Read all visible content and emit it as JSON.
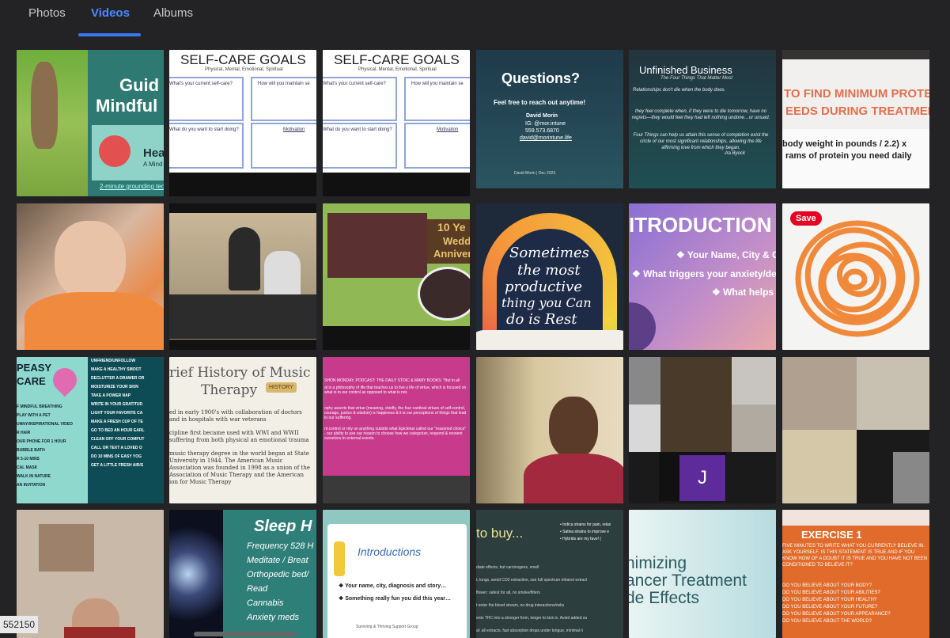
{
  "tabs": [
    {
      "label": "Photos"
    },
    {
      "label": "Videos"
    },
    {
      "label": "Albums"
    }
  ],
  "video_count_label": "552150",
  "tiles": {
    "t1": {
      "title": "Guid",
      "title2": "Mindful",
      "sub": "Hea",
      "sub2": "A Mind",
      "link": "2-minute grounding techni"
    },
    "t2": {
      "title": "SELF-CARE GOALS",
      "sub": "Physical, Mental, Emotional, Spiritual",
      "q1": "What's your current self-care?",
      "q2": "How will you maintain se",
      "q3": "What do you want to start doing?",
      "q4": "Motivation"
    },
    "t3": {
      "title": "SELF-CARE GOALS",
      "sub": "Physical, Mental, Emotional, Spiritual",
      "q1": "What's your current self-care?",
      "q2": "How will you maintain se",
      "q3": "What do you want to start doing?",
      "q4": "Motivation"
    },
    "t4": {
      "title": "Questions?",
      "line1": "Feel free to reach out anytime!",
      "name": "David Morin",
      "ig": "IG: @mor.intune",
      "phone": "559.573.6870",
      "email": "david@morintune.life",
      "footer": "David Morin | Dec 2023"
    },
    "t5": {
      "title": "Unfinished Business",
      "sub": "The Four Things That Matter Most",
      "q1": "Relationships don't die when the body does.",
      "q2": "they feel complete when, if they were to die tomorrow, have no regrets—they would feel they had left nothing undone…or unsaid.",
      "q3": "Four Things can help us attain this sense of completion exist the circle of our most significant relationships, allowing the life affirming love from which they began.",
      "author": "-Ira Byock"
    },
    "t6": {
      "title": "TO FIND MINIMUM PROTEIN",
      "title2": "EEDS DURING TREATMENT",
      "line1": "body weight in pounds / 2.2) x",
      "line2": "rams of protein you need daily"
    },
    "t9": {
      "title": "10 Ye",
      "title2": "Wedd",
      "title3": "Anniver"
    },
    "t10": {
      "l1": "Sometimes",
      "l2": "the most",
      "l3": "productive",
      "l4": "thing you Can",
      "l5": "do is Rest"
    },
    "t11": {
      "title": "ITRODUCTION",
      "l1": "❖ Your Name, City & C",
      "l2": "❖ What triggers your anxiety/de",
      "l3": "❖ What helps"
    },
    "t12": {
      "save": "Save"
    },
    "t13": {
      "title": "PEASY",
      "title2": "CARE",
      "left": [
        "F MINDFUL BREATHING",
        "PLAY WITH A PET",
        "UNNY/INSPIRATIONAL VIDEO",
        "R HAIR",
        "OUR PHONE FOR 1 HOUR",
        "BUBBLE BATH",
        "R 5-10 MINS",
        "CAL MASK",
        "WALK IN NATURE",
        "AN INVITATION"
      ],
      "right": [
        "UNFRIEND/UNFOLLOW",
        "MAKE A HEALTHY SMOOT",
        "DECLUTTER A DRAWER OR",
        "MOISTURIZE YOUR SKIN",
        "TAKE A POWER NAP",
        "WRITE IN YOUR GRATITUD",
        "LIGHT YOUR FAVORITE CA",
        "MAKE A FRESH CUP OF TE",
        "GO TO BED AN HOUR EARL",
        "CLEAN OFF YOUR COMPUT",
        "CALL OR TEXT A LOVED O",
        "DO 10 MINS OF EASY YOG",
        "GET A LITTLE FRESH AIR/S"
      ]
    },
    "t14": {
      "title": "rief History of Music",
      "title2": "Therapy",
      "badge": "HISTORY",
      "p1": "ed in early 1900's with collaboration of doctors and in hospitals with war veterans",
      "p2": "cipline first became used with WWI and WWII suffering from both physical an emotional trauma",
      "p3": "music therapy degree in the world began at State University in 1944. The American Music Association was founded in 1998 as a union of the Association of Music Therapy and the American ion for Music Therapy"
    },
    "t15": {
      "head": "SHON MONDAY, PODCAST: THE DAILY STOIC & MANY BOOKS: \"But in all",
      "p1": "at is a philosophy of life that teaches us to live a life of virtue, which is focused on what is in our control as opposed to what is not.",
      "p2": "ophy asserts that virtue (meaning, chiefly, the four cardinal virtues of self-control, courage, justice & wisdom) is happiness & it is our perceptions of things that lead to our suffering.",
      "p3": "nt control or rely on anything outside what Epictetus called our \"reasoned choice\" - our ability to use our reason to choose how we categorize, respond & reorient ourselves to external events."
    },
    "t17": {
      "avatar": "J"
    },
    "t20": {
      "title": "Sleep H",
      "items": [
        "Frequency 528 H",
        "Meditate / Breat",
        "Orthopedic bed/",
        "Read",
        "Cannabis",
        "Anxiety meds"
      ]
    },
    "t21": {
      "title": "Introductions",
      "l1": "❖ Your name, city, diagnosis and story…",
      "l2": "❖ Something really fun you did this year…",
      "footer": "Surviving & Thriving Support Group"
    },
    "t22": {
      "title": "to buy...",
      "b1": "• Indica strains for pain, relax",
      "b2": "• Sativa strains to improve e",
      "b3": "• Hybrids are my fave! (",
      "l1": "diate effects, but carcinogens, smell",
      "l2": "t, lungs, avoid CO2 extraction, use full spectrum ethanol extract",
      "l3": "flower: safest for all, no smoke/filters",
      "l4": "ents THC into a stronger form, longer to kick in. Avoid added su",
      "l5": "al: all extracts, fast absorption drops under tongue, minimal ri",
      "l6": "t enter the blood stream, no drug interactions/risks"
    },
    "t23": {
      "l1": "nimizing",
      "l2": "ancer Treatment",
      "l3": "de Effects"
    },
    "t24": {
      "title": "EXERCISE 1",
      "p1": "FIVE MINUTES TO WRITE WHAT YOU CURRENTLY BELIEVE IN. ASK YOURSELF, IS THIS STATEMENT IS TRUE AND IF YOU KNOW HOW OF A DOUBT IT IS TRUE AND YOU HAVE NOT BEEN CONDITIONED TO BELIEVE IT?",
      "q": [
        "DO YOU BELIEVE ABOUT YOUR BODY?",
        "DO YOU BELIEVE ABOUT YOUR ABILITIES?",
        "DO YOU BELIEVE ABOUT YOUR HEALTH?",
        "DO YOU BELIEVE ABOUT YOUR FUTURE?",
        "DO YOU BELIEVE ABOUT YOUR APPEARANCE?",
        "DO YOU BELIEVE ABOUT THE WORLD?"
      ]
    }
  },
  "colors": {
    "background": "#232325",
    "accent": "#3877f0",
    "tab_text": "#c8c8cc"
  }
}
